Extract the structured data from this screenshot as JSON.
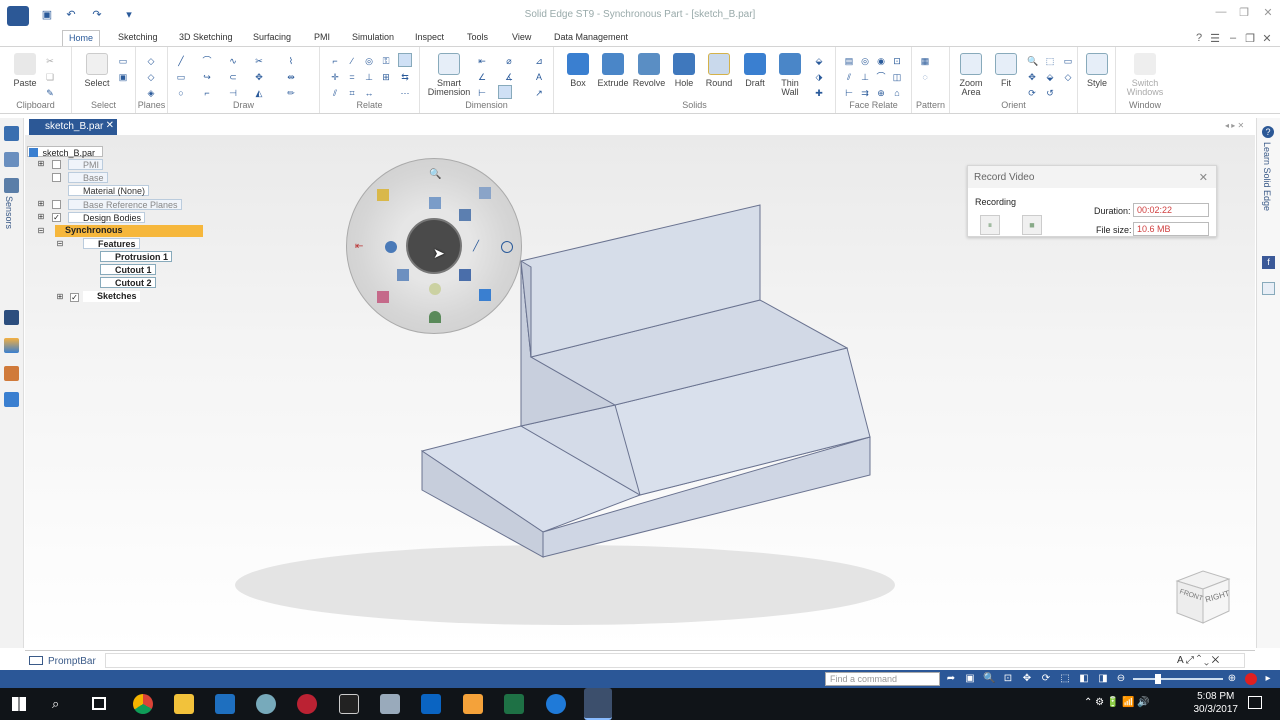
{
  "app": {
    "title": "Solid Edge ST9 - Synchronous Part - [sketch_B.par]"
  },
  "ribbon": {
    "tabs": [
      "Home",
      "Sketching",
      "3D Sketching",
      "Surfacing",
      "PMI",
      "Simulation",
      "Inspect",
      "Tools",
      "View",
      "Data Management"
    ],
    "groups": {
      "clipboard": {
        "label": "Clipboard",
        "paste": "Paste"
      },
      "select": {
        "label": "Select",
        "select": "Select"
      },
      "planes": {
        "label": "Planes"
      },
      "draw": {
        "label": "Draw"
      },
      "relate": {
        "label": "Relate"
      },
      "dimension": {
        "label": "Dimension",
        "smart": "Smart Dimension"
      },
      "solids": {
        "label": "Solids",
        "buttons": [
          "Box",
          "Extrude",
          "Revolve",
          "Hole",
          "Round",
          "Draft",
          "Thin Wall"
        ]
      },
      "face_relate": {
        "label": "Face Relate"
      },
      "pattern": {
        "label": "Pattern"
      },
      "orient": {
        "label": "Orient",
        "zoom": "Zoom Area",
        "fit": "Fit"
      },
      "style": {
        "label": "Style"
      },
      "window": {
        "label": "Window",
        "switch": "Switch Windows"
      }
    }
  },
  "document_tab": "sketch_B.par",
  "tree": {
    "root": "sketch_B.par",
    "items": [
      "PMI",
      "Base",
      "Material (None)",
      "Base Reference Planes",
      "Design Bodies",
      "Synchronous",
      "Features",
      "Protrusion 1",
      "Cutout 1",
      "Cutout 2",
      "Sketches"
    ]
  },
  "sidebar": {
    "sensors": "Sensors",
    "learn": "Learn Solid Edge"
  },
  "record_dialog": {
    "title": "Record Video",
    "recording_label": "Recording",
    "duration_label": "Duration:",
    "duration_value": "00:02:22",
    "filesize_label": "File size:",
    "filesize_value": "10.6 MB"
  },
  "view_cube": {
    "front": "FRONT",
    "right": "RIGHT"
  },
  "prompt_bar": "PromptBar",
  "status_bar": {
    "find_placeholder": "Find a command"
  },
  "taskbar": {
    "time": "5:08 PM",
    "date": "30/3/2017"
  },
  "colors": {
    "accent": "#2b5797",
    "tab_blue": "#2c5896",
    "selection": "#f6b73c",
    "model_face": "#d4dbe8"
  }
}
